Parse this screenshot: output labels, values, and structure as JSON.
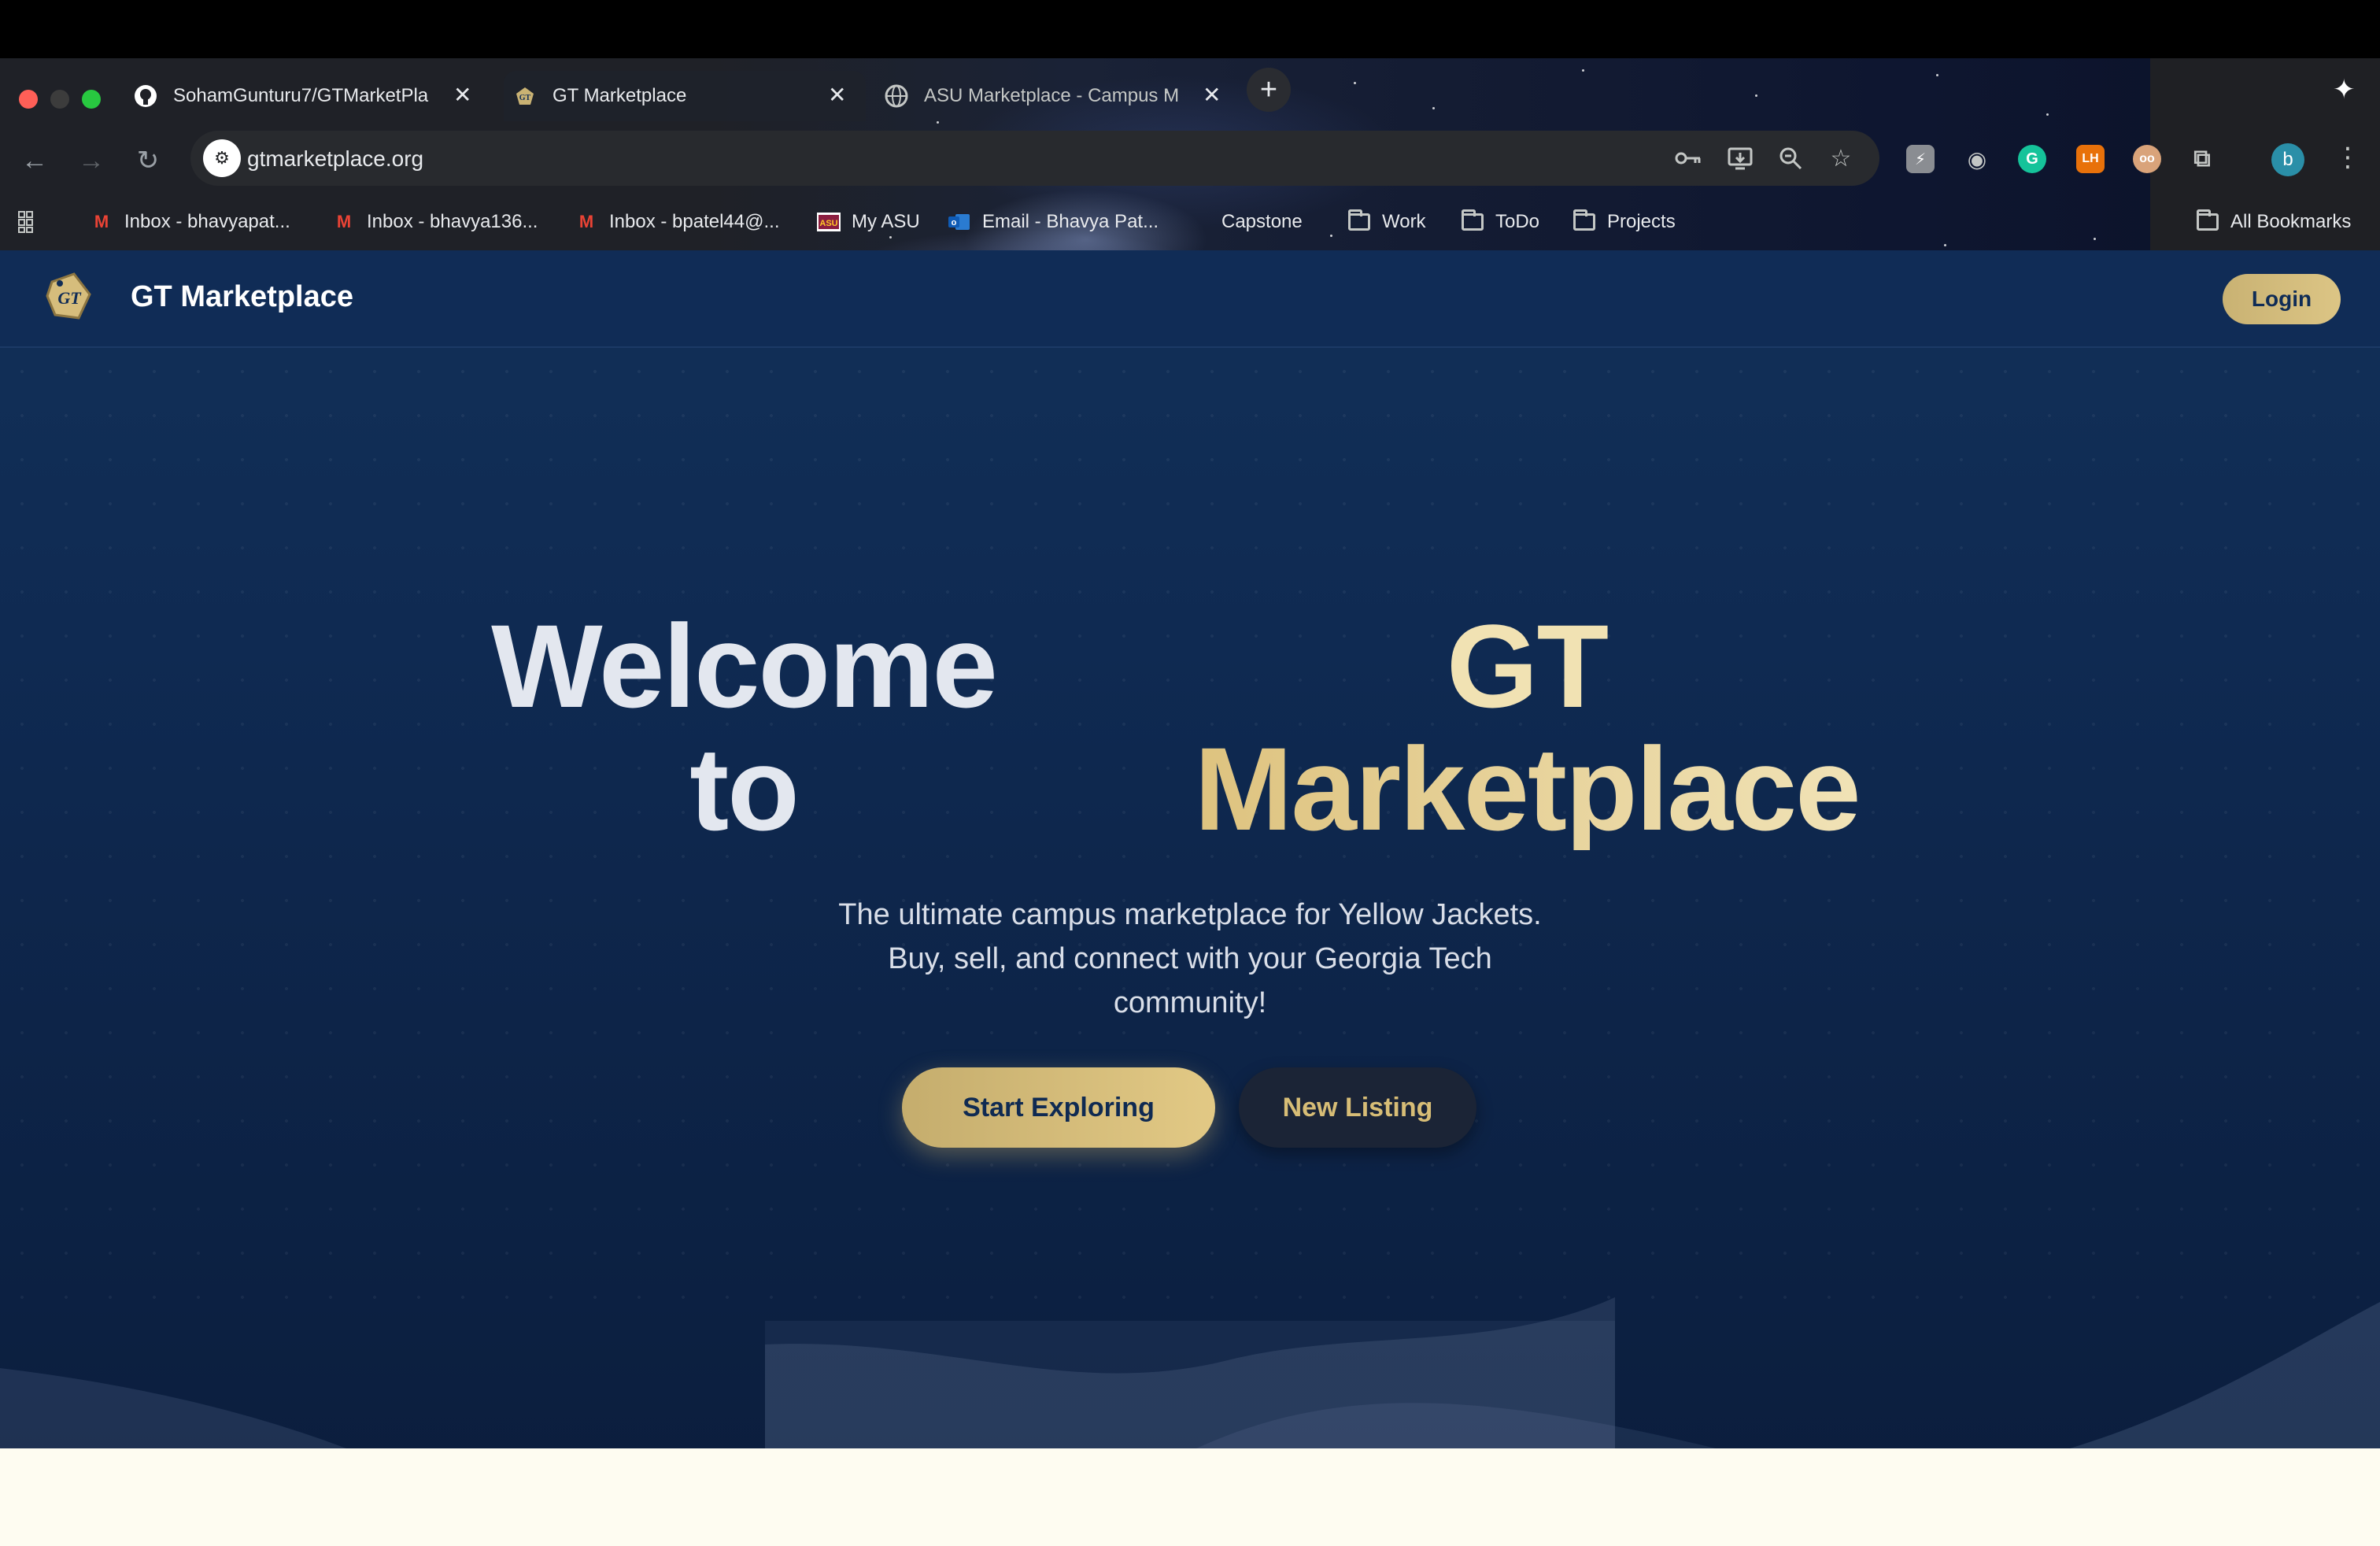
{
  "browser": {
    "tabs": [
      {
        "title": "SohamGunturu7/GTMarketPla",
        "icon": "github-icon",
        "active": false
      },
      {
        "title": "GT Marketplace",
        "icon": "gt-logo-icon",
        "active": true
      },
      {
        "title": "ASU Marketplace - Campus M",
        "icon": "globe-icon",
        "active": false
      }
    ],
    "url": "gtmarketplace.org",
    "bookmarks": [
      {
        "label": "Inbox - bhavyapat...",
        "icon": "gmail-icon"
      },
      {
        "label": "Inbox - bhavya136...",
        "icon": "gmail-icon"
      },
      {
        "label": "Inbox - bpatel44@...",
        "icon": "gmail-icon"
      },
      {
        "label": "My ASU",
        "icon": "asu-icon"
      },
      {
        "label": "Email - Bhavya Pat...",
        "icon": "outlook-icon"
      },
      {
        "label": "Capstone",
        "icon": "blank-icon"
      },
      {
        "label": "Work",
        "icon": "folder-icon"
      },
      {
        "label": "ToDo",
        "icon": "folder-icon"
      },
      {
        "label": "Projects",
        "icon": "folder-icon"
      }
    ],
    "all_bookmarks": "All Bookmarks",
    "profile_initial": "b"
  },
  "site": {
    "brand": "GT Marketplace",
    "login": "Login"
  },
  "hero": {
    "welcome_line1": "Welcome",
    "welcome_line2": "to",
    "gold_line1": "GT",
    "gold_line2": "Marketplace",
    "tagline_line1": "The ultimate campus marketplace for Yellow Jackets.",
    "tagline_line2": "Buy, sell, and connect with your Georgia Tech",
    "tagline_line3": "community!",
    "primary_cta": "Start Exploring",
    "secondary_cta": "New Listing"
  },
  "colors": {
    "navy": "#102c56",
    "gold": "#dcc585",
    "cream": "#fefcf1"
  }
}
